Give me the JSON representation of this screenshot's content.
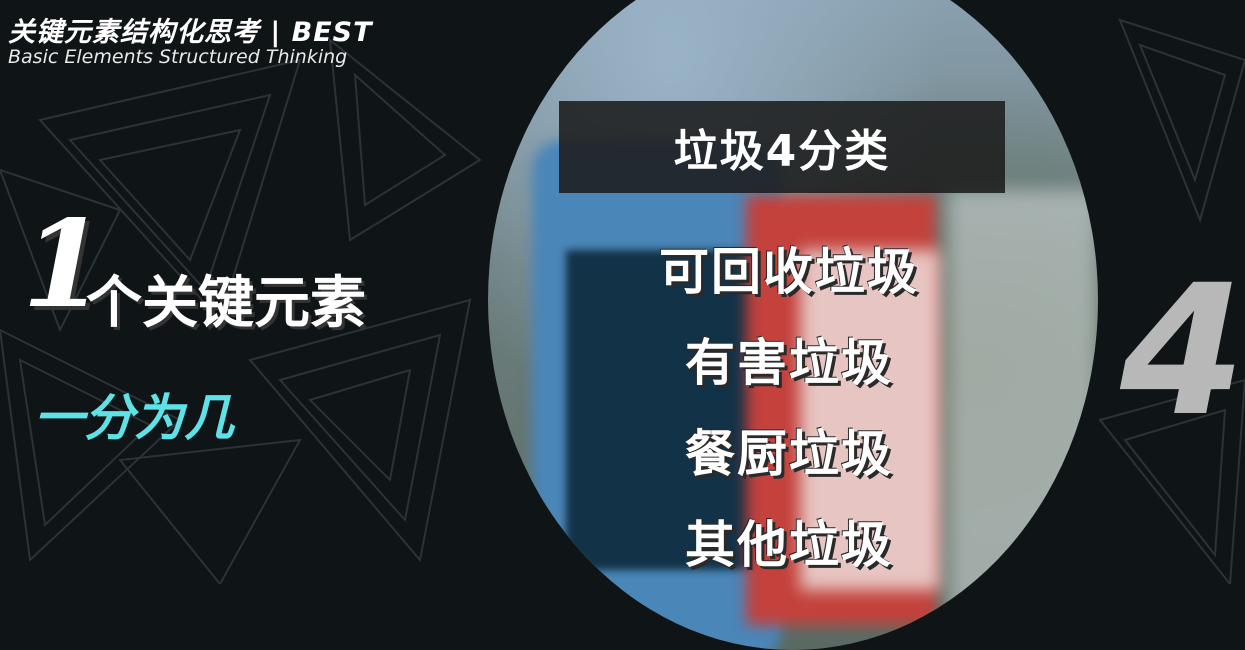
{
  "brand": {
    "title": "关键元素结构化思考 | BEST",
    "subtitle": "Basic Elements Structured Thinking"
  },
  "left_panel": {
    "number": "1",
    "label": "个关键元素",
    "tagline": "一分为几"
  },
  "center_panel": {
    "title": "垃圾4分类",
    "categories": [
      "可回收垃圾",
      "有害垃圾",
      "餐厨垃圾",
      "其他垃圾"
    ]
  },
  "right_panel": {
    "count": "4"
  },
  "colors": {
    "background": "#0f1416",
    "accent_cyan": "#5ee2e8",
    "text_white": "#ffffff",
    "count_gray": "#b8b8b8"
  }
}
